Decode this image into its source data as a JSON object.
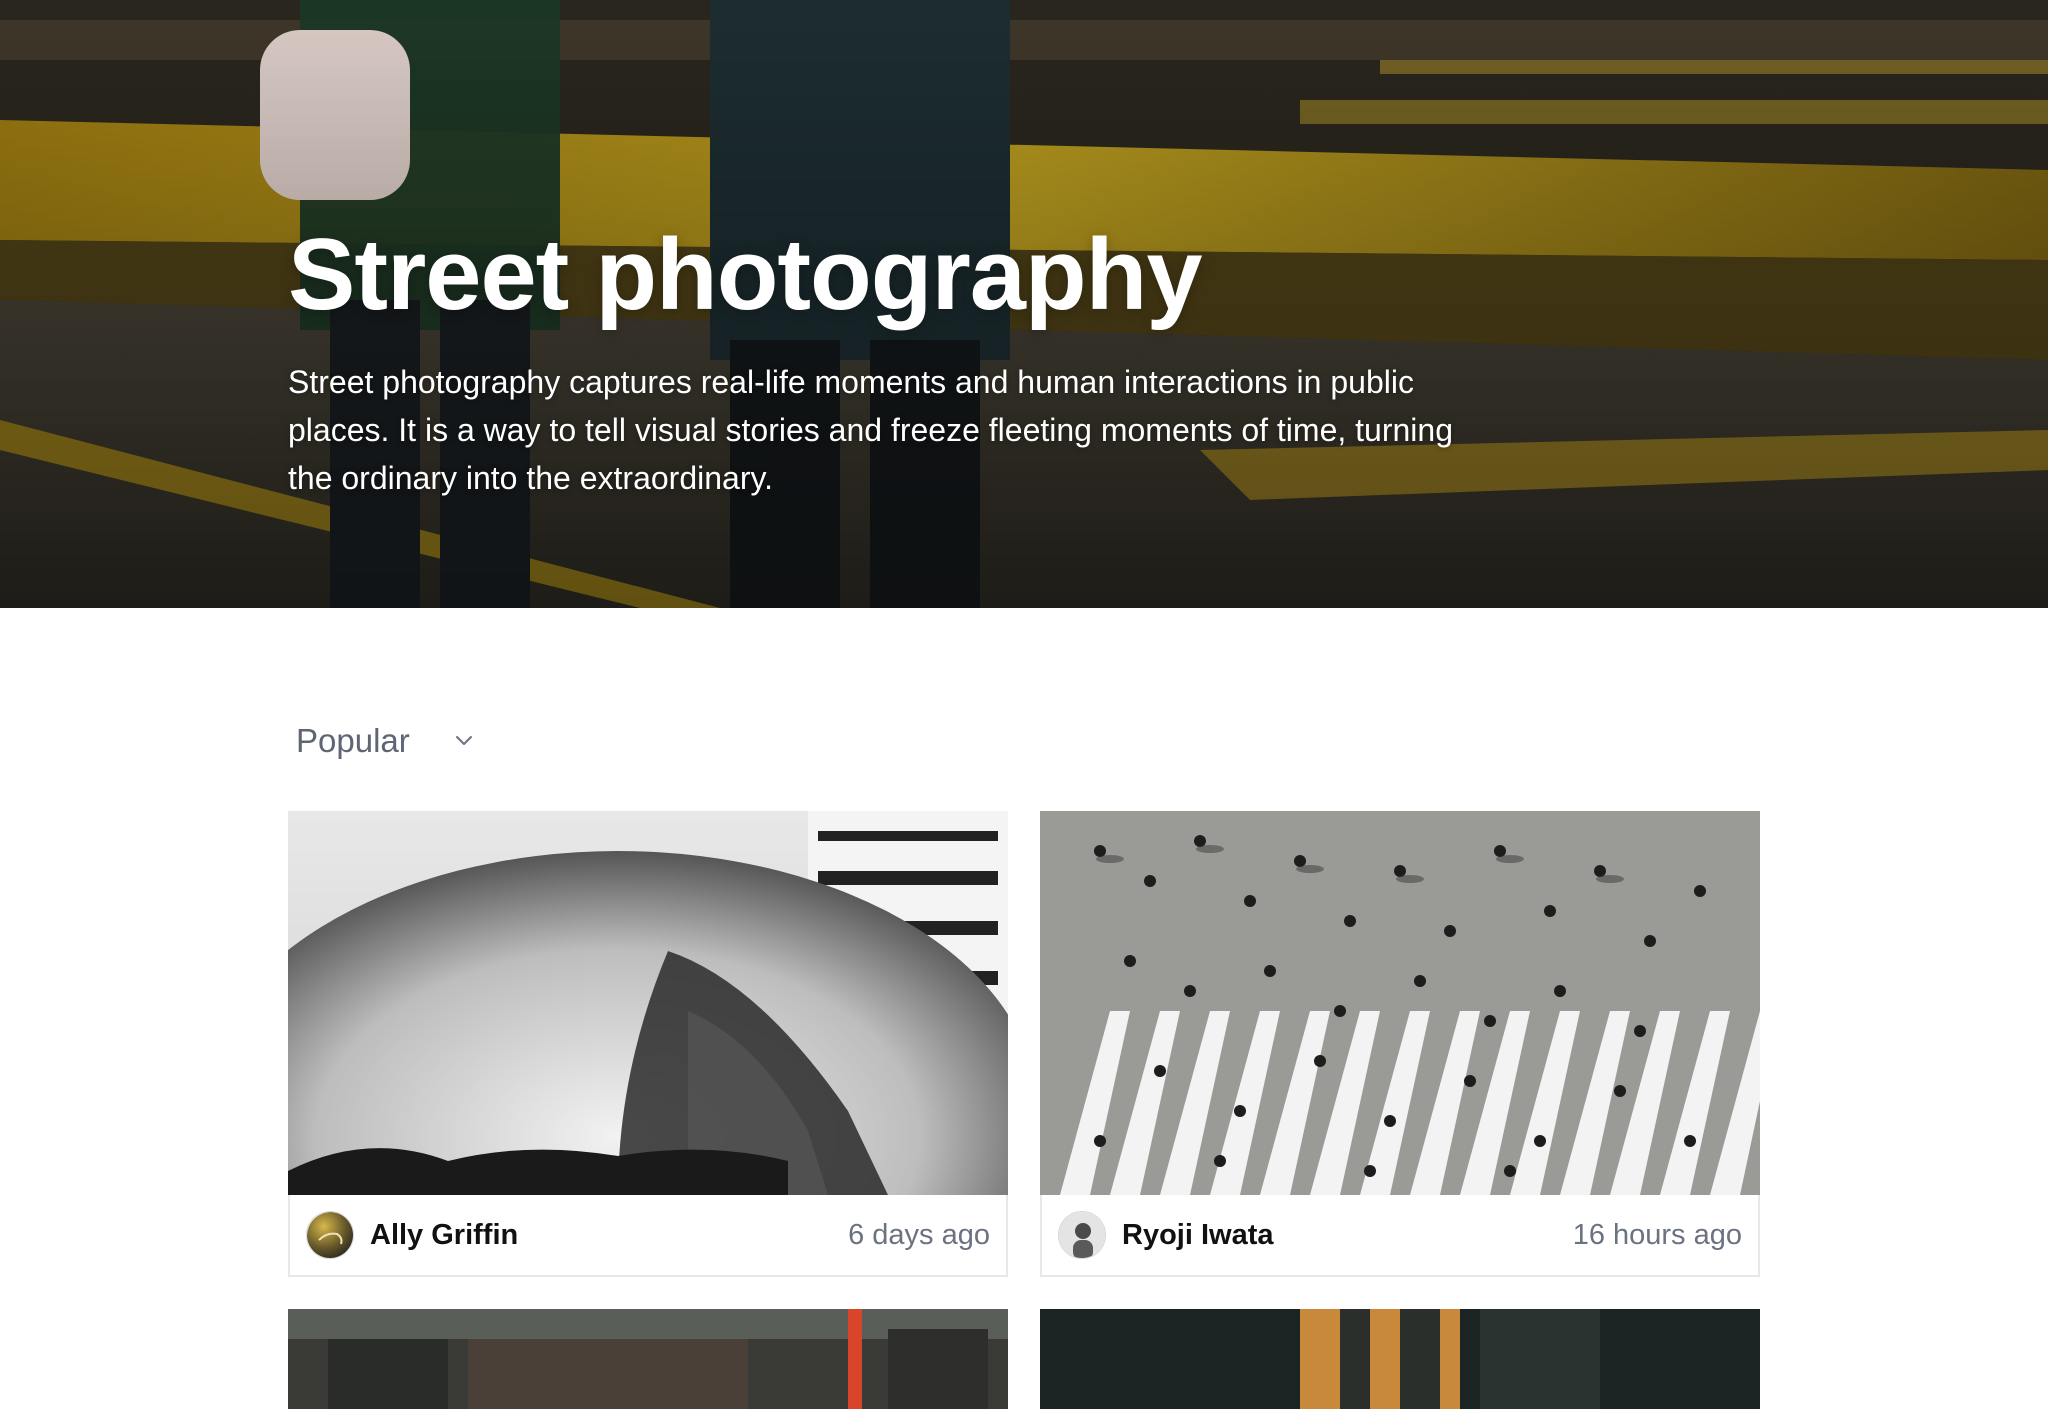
{
  "hero": {
    "title": "Street photography",
    "description": "Street photography captures real-life moments and human interactions in public places. It is a way to tell visual stories and freeze fleeting moments of time, turning the ordinary into the extraordinary."
  },
  "sort": {
    "selected": "Popular",
    "icon": "chevron-down-icon"
  },
  "cards": [
    {
      "author": "Ally Griffin",
      "time": "6 days ago"
    },
    {
      "author": "Ryoji Iwata",
      "time": "16 hours ago"
    },
    {
      "author": "",
      "time": ""
    },
    {
      "author": "",
      "time": ""
    }
  ],
  "colors": {
    "text_muted": "#6b7280",
    "card_border": "#e6e7ea",
    "hero_accent_yellow": "#c9a70e"
  }
}
